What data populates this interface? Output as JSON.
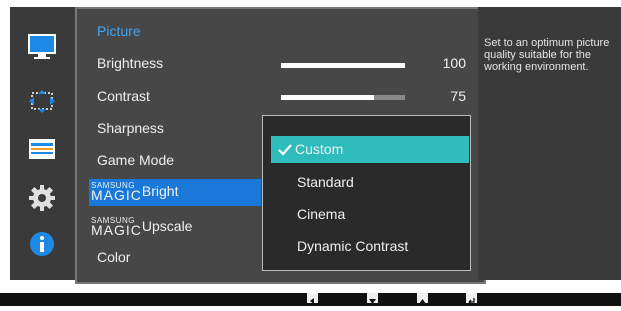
{
  "menu": {
    "title": "Picture",
    "items": {
      "brightness": {
        "label": "Brightness",
        "value": "100",
        "fraction": 1.0
      },
      "contrast": {
        "label": "Contrast",
        "value": "75",
        "fraction": 0.75
      },
      "sharpness": {
        "label": "Sharpness"
      },
      "game_mode": {
        "label": "Game Mode"
      },
      "magic_bright": {
        "brand": "SAMSUNG",
        "magic": "MAGIC",
        "label": "Bright"
      },
      "magic_upscale": {
        "brand": "SAMSUNG",
        "magic": "MAGIC",
        "label": "Upscale"
      },
      "color": {
        "label": "Color"
      }
    }
  },
  "dropdown": {
    "options": [
      "Custom",
      "Standard",
      "Cinema",
      "Dynamic Contrast"
    ],
    "selected": "Custom"
  },
  "help": {
    "text": "Set to an optimum picture quality suitable for the working environment."
  },
  "sidebar": {
    "icons": [
      "monitor-icon",
      "resize-icon",
      "settings-panel-icon",
      "gear-icon",
      "info-icon"
    ]
  },
  "navigation": {
    "buttons": [
      "left-arrow-icon",
      "down-arrow-icon",
      "up-arrow-icon",
      "enter-icon"
    ]
  },
  "colors": {
    "highlight": "#1a79d8",
    "selected_option": "#2ebcbd",
    "menu_title": "#3da5f5"
  }
}
